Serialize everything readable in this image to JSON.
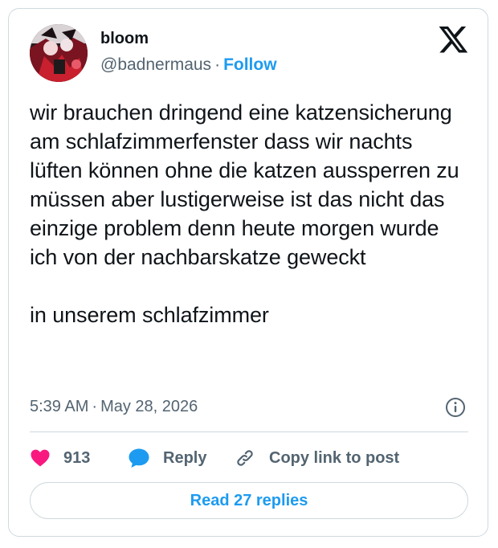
{
  "author": {
    "display_name": "bloom",
    "handle": "@badnermaus",
    "separator": "·",
    "follow_label": "Follow"
  },
  "tweet": {
    "text": "wir brauchen dringend eine katzensicherung am schlafzimmerfenster dass wir nachts lüften können ohne die katzen aussperren zu müssen aber lustigerweise ist das nicht das einzige problem denn heute morgen wurde ich von der nachbarskatze geweckt\n\nin unserem schlafzimmer",
    "time": "5:39 AM",
    "separator": "·",
    "date": "May 28, 2026"
  },
  "actions": {
    "like_count": "913",
    "reply_label": "Reply",
    "copy_link_label": "Copy link to post"
  },
  "read_replies_label": "Read 27 replies",
  "icons": {
    "brand": "x-logo-icon",
    "info": "info-icon",
    "like": "heart-icon",
    "reply": "reply-bubble-icon",
    "copy": "link-icon"
  },
  "colors": {
    "accent": "#1d9bf0",
    "like": "#f91880",
    "muted_text": "#536471",
    "border": "#cfd9de",
    "text": "#0f1419"
  }
}
